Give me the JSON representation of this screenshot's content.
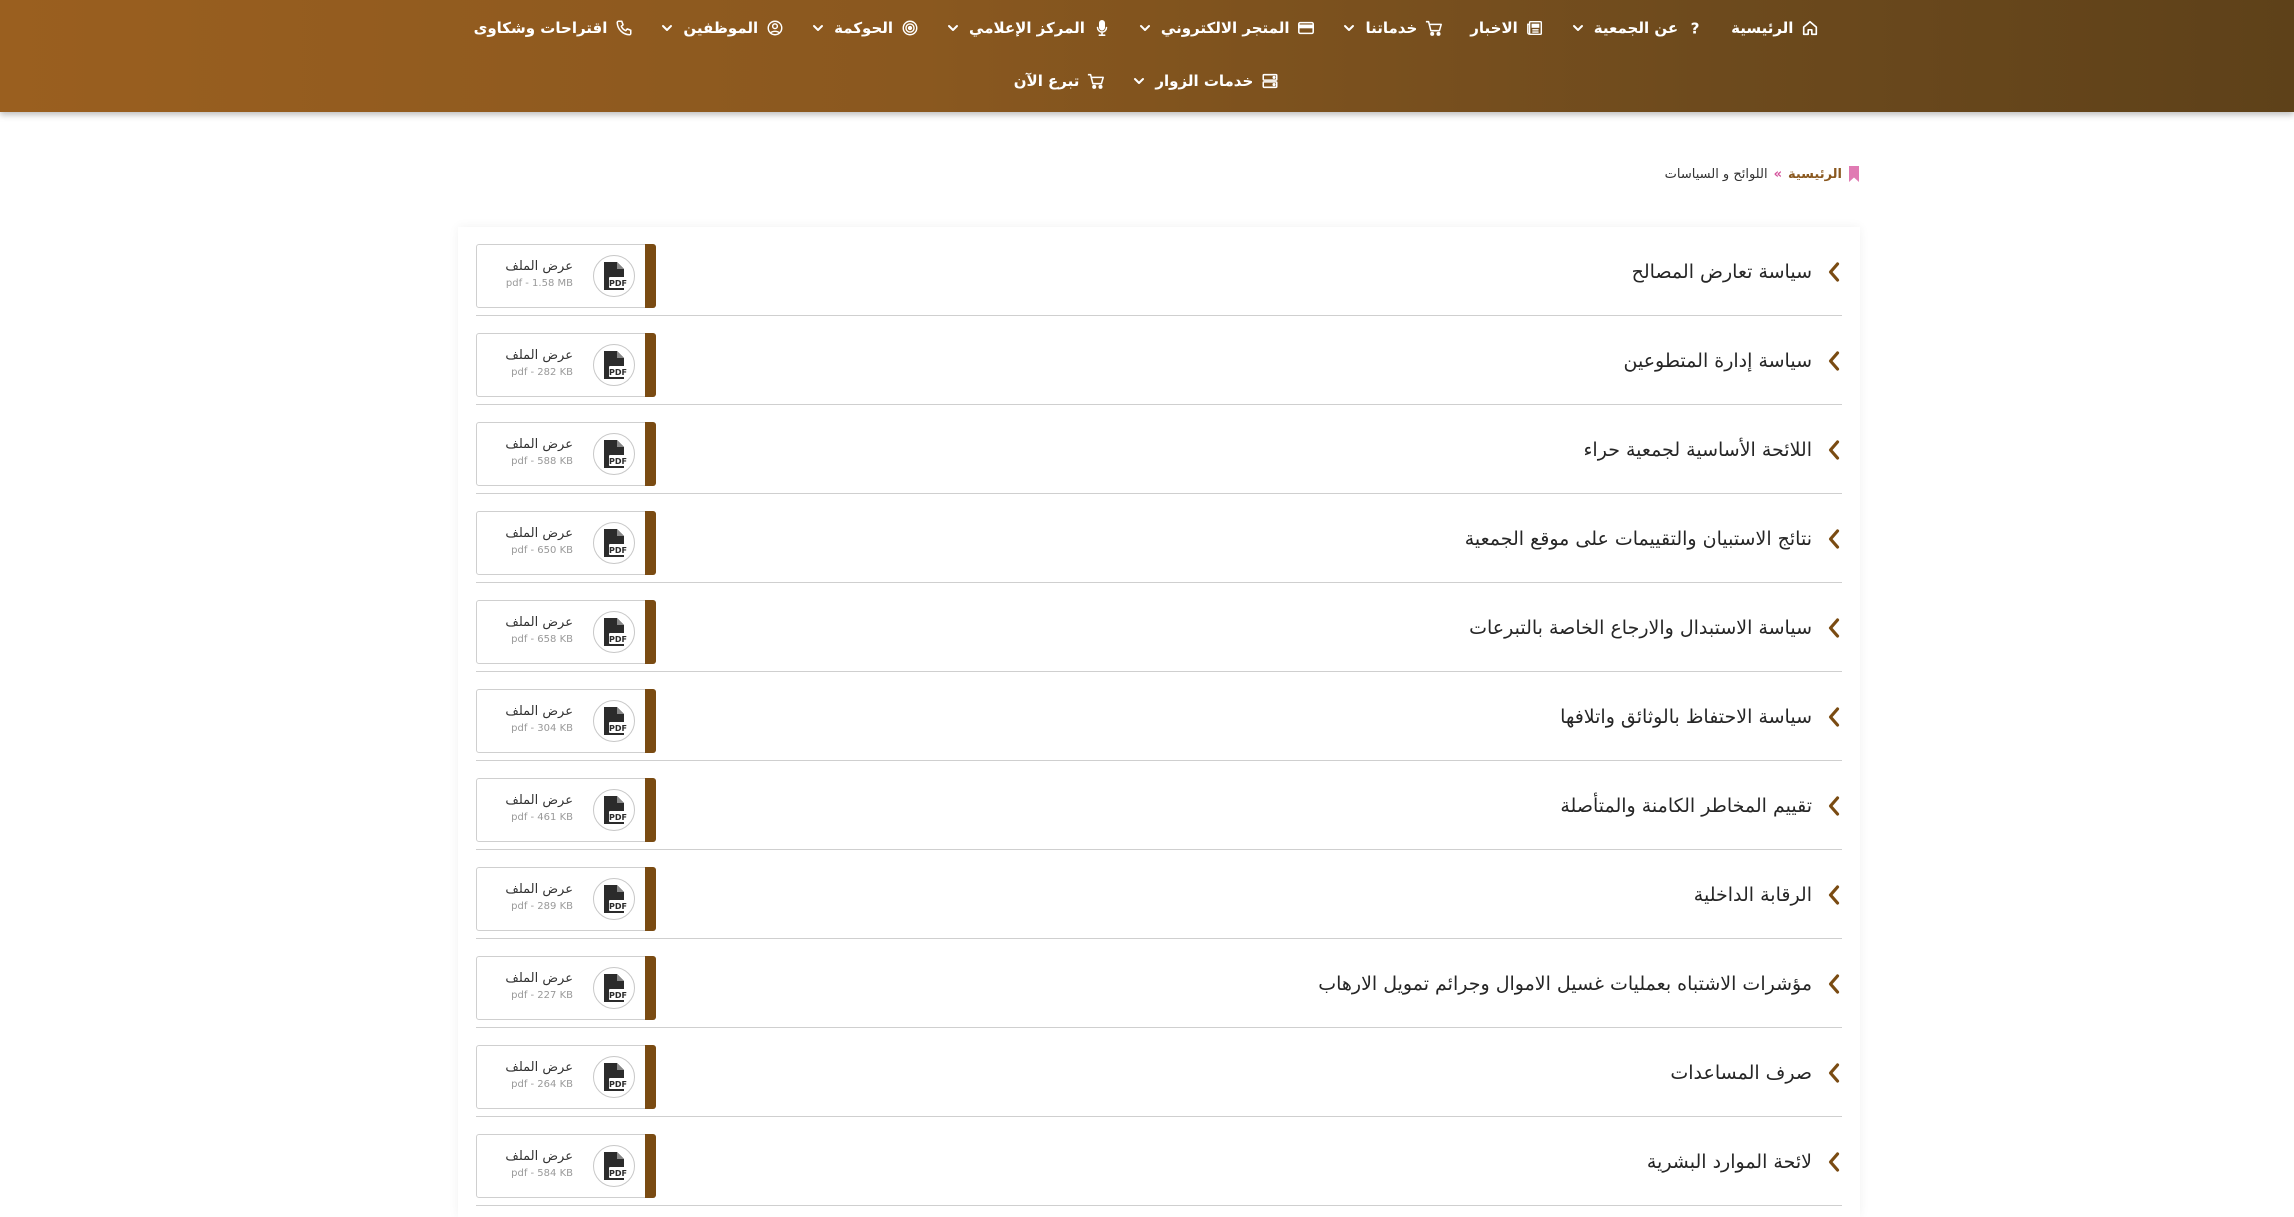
{
  "nav": {
    "row1": [
      {
        "label": "الرئيسية",
        "icon": "home-icon",
        "dropdown": false
      },
      {
        "label": "عن الجمعية",
        "icon": "question-icon",
        "dropdown": true
      },
      {
        "label": "الاخبار",
        "icon": "newspaper-icon",
        "dropdown": false
      },
      {
        "label": "خدماتنا",
        "icon": "cart-icon",
        "dropdown": true
      },
      {
        "label": "المتجر الالكتروني",
        "icon": "credit-card-icon",
        "dropdown": true
      },
      {
        "label": "المركز الإعلامي",
        "icon": "microphone-icon",
        "dropdown": true
      },
      {
        "label": "الحوكمة",
        "icon": "target-icon",
        "dropdown": true
      },
      {
        "label": "الموظفين",
        "icon": "user-circle-icon",
        "dropdown": true
      },
      {
        "label": "اقتراحات وشكاوى",
        "icon": "phone-icon",
        "dropdown": false
      }
    ],
    "row2": [
      {
        "label": "خدمات الزوار",
        "icon": "server-icon",
        "dropdown": true
      },
      {
        "label": "تبرع الآن",
        "icon": "cart-icon",
        "dropdown": false
      }
    ]
  },
  "breadcrumb": {
    "home": "الرئيسية",
    "separator": "»",
    "current": "اللوائح و السياسات"
  },
  "file_label": "عرض الملف",
  "documents": [
    {
      "title": "سياسة تعارض المصالح",
      "meta": "pdf - 1.58 MB"
    },
    {
      "title": "سياسة إدارة المتطوعين",
      "meta": "pdf - 282 KB"
    },
    {
      "title": "اللائحة الأساسية لجمعية حراء",
      "meta": "pdf - 588 KB"
    },
    {
      "title": "نتائج الاستبيان والتقييمات على موقع الجمعية",
      "meta": "pdf - 650 KB"
    },
    {
      "title": "سياسة الاستبدال والارجاع الخاصة بالتبرعات",
      "meta": "pdf - 658 KB"
    },
    {
      "title": "سياسة الاحتفاظ بالوثائق واتلافها",
      "meta": "pdf - 304 KB"
    },
    {
      "title": "تقييم المخاطر الكامنة والمتأصلة",
      "meta": "pdf - 461 KB"
    },
    {
      "title": "الرقابة الداخلية",
      "meta": "pdf - 289 KB"
    },
    {
      "title": "مؤشرات الاشتباه بعمليات غسيل الاموال وجرائم تمويل الارهاب",
      "meta": "pdf - 227 KB"
    },
    {
      "title": "صرف المساعدات",
      "meta": "pdf - 264 KB"
    },
    {
      "title": "لائحة الموارد البشرية",
      "meta": "pdf - 584 KB"
    }
  ],
  "colors": {
    "header_start": "#9a5f1f",
    "header_end": "#5e4119",
    "accent_bar": "#7a4b12",
    "breadcrumb_home": "#8a581f",
    "breadcrumb_sep": "#d4529b"
  }
}
